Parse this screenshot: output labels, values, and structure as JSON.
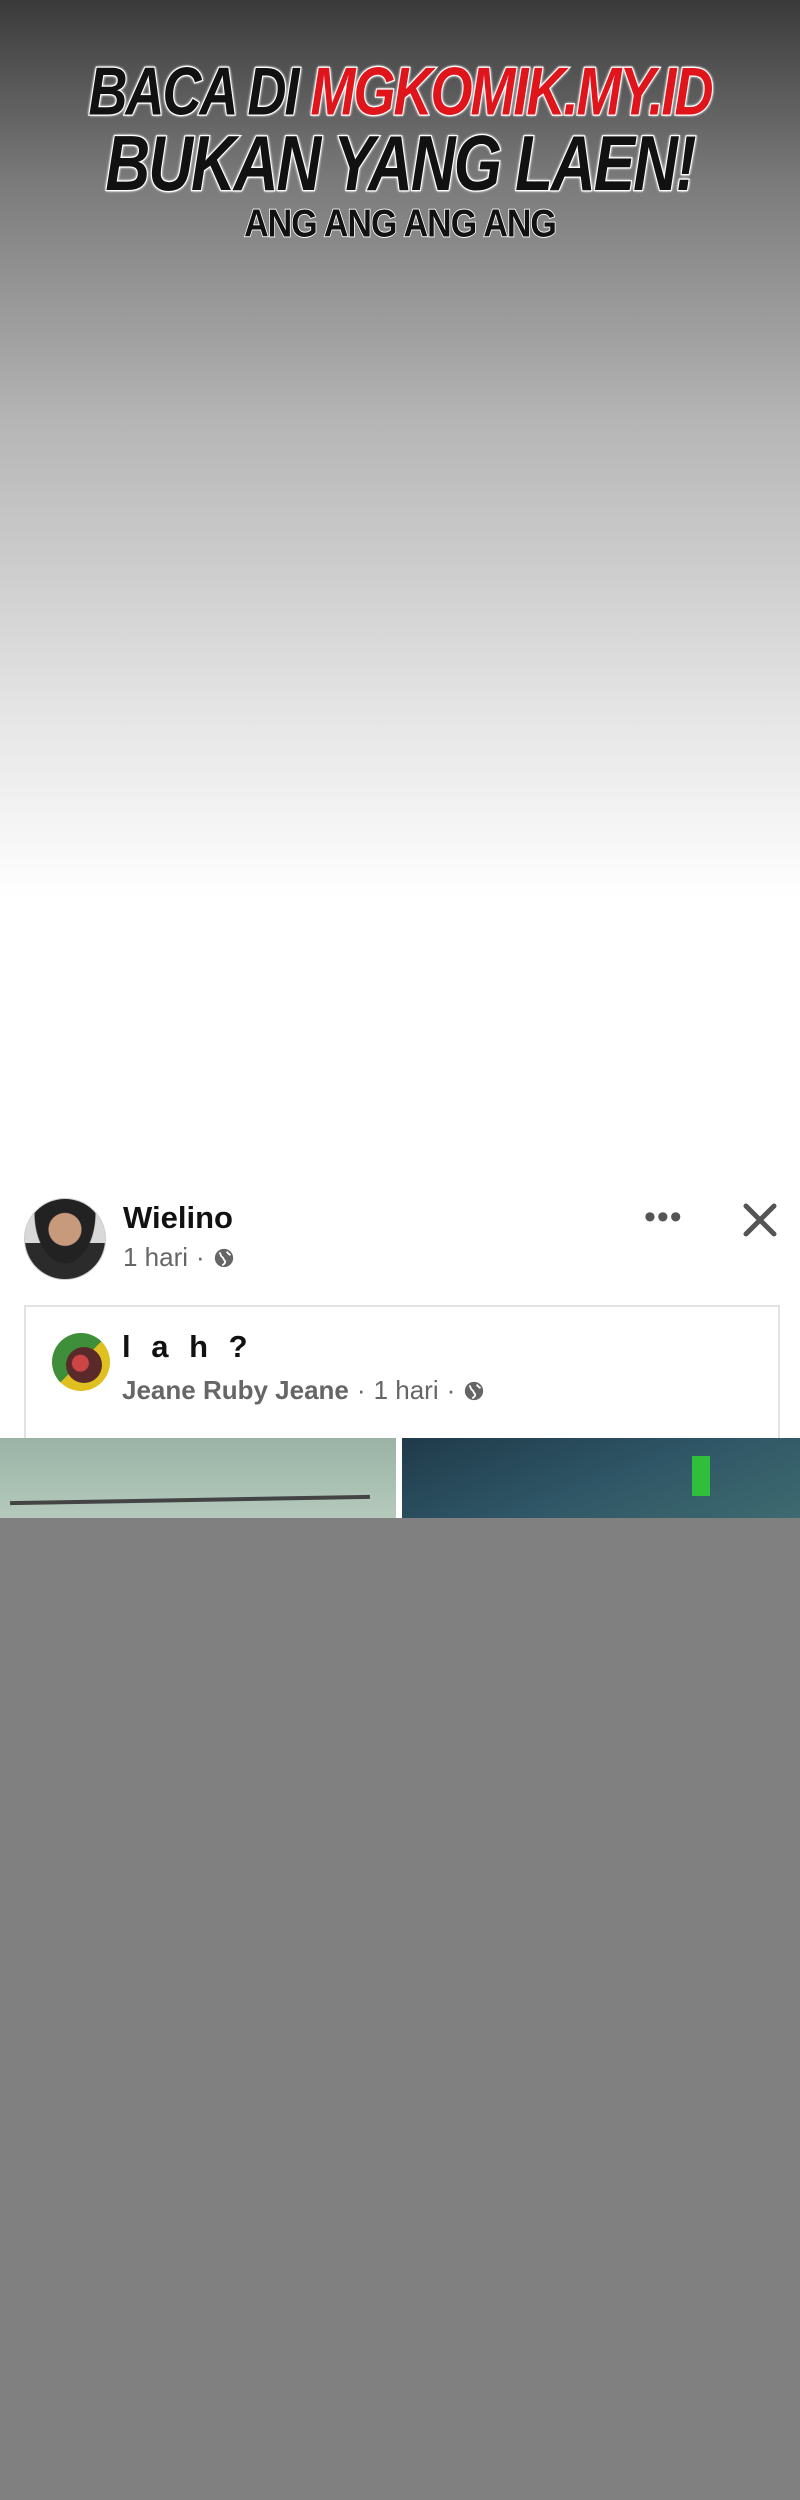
{
  "banner": {
    "line1_prefix": "BACA DI ",
    "line1_accent": "MGKOMIK.MY.ID",
    "line2": "BUKAN YANG LAEN!",
    "line3": "ANG ANG ANG ANG"
  },
  "post": {
    "author": "Wielino",
    "time": "1 hari",
    "dot": "·",
    "more_label": "•••",
    "shared": {
      "title": "l a h ?",
      "author": "Jeane Ruby Jeane",
      "time": "1 hari",
      "dot": "·"
    }
  },
  "colors": {
    "accent": "#e0141b",
    "placeholder_gray": "#808080"
  },
  "icons": [
    "globe-icon",
    "more-icon",
    "close-icon"
  ]
}
